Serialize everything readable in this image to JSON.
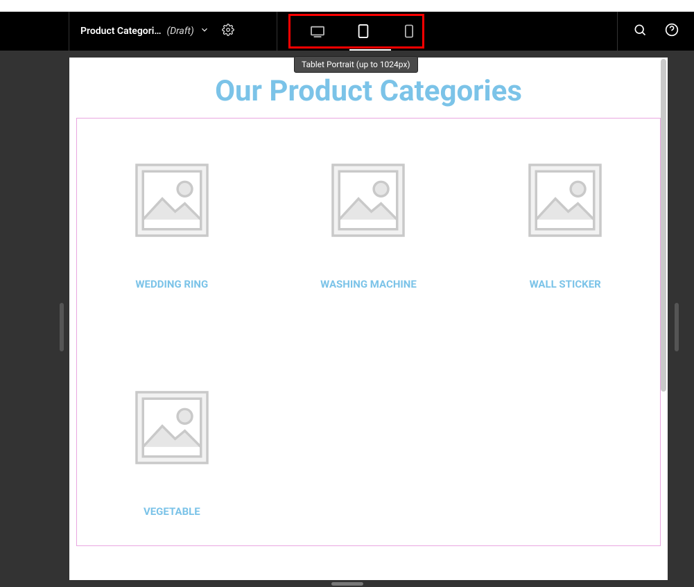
{
  "header": {
    "page_title": "Product Categori…",
    "status_label": "(Draft)"
  },
  "devices": {
    "tooltip": "Tablet Portrait (up to 1024px)"
  },
  "page": {
    "heading": "Our Product Categories",
    "categories": [
      {
        "name": "WEDDING RING"
      },
      {
        "name": "WASHING MACHINE"
      },
      {
        "name": "WALL STICKER"
      },
      {
        "name": "VEGETABLE"
      }
    ]
  }
}
